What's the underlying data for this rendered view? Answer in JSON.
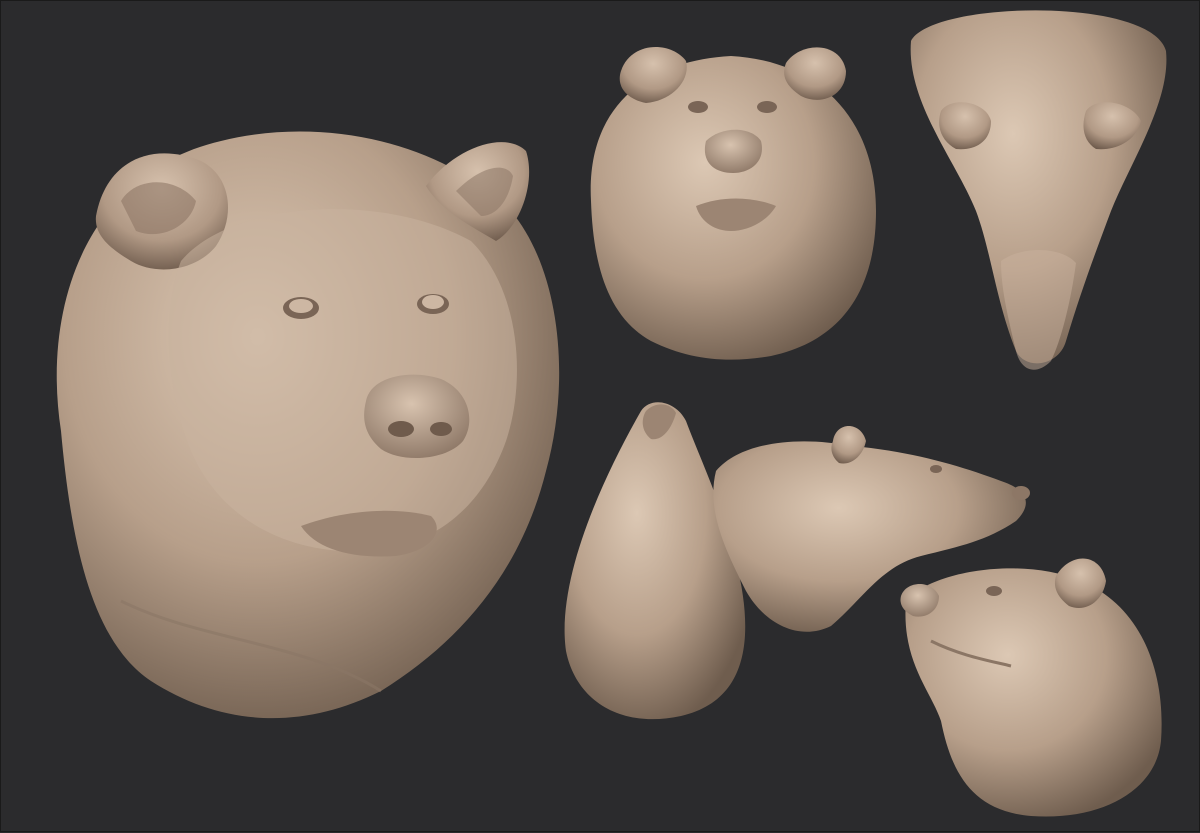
{
  "scene": {
    "background": "#2b2b2d",
    "clay_color": "#bfa793",
    "clay_highlight": "#d9c4b0",
    "clay_shadow": "#6e5b4c",
    "views": [
      {
        "id": "front-three-quarter",
        "label": ""
      },
      {
        "id": "front",
        "label": ""
      },
      {
        "id": "top",
        "label": ""
      },
      {
        "id": "bottom",
        "label": ""
      },
      {
        "id": "side",
        "label": ""
      },
      {
        "id": "three-quarter-low",
        "label": ""
      }
    ]
  }
}
